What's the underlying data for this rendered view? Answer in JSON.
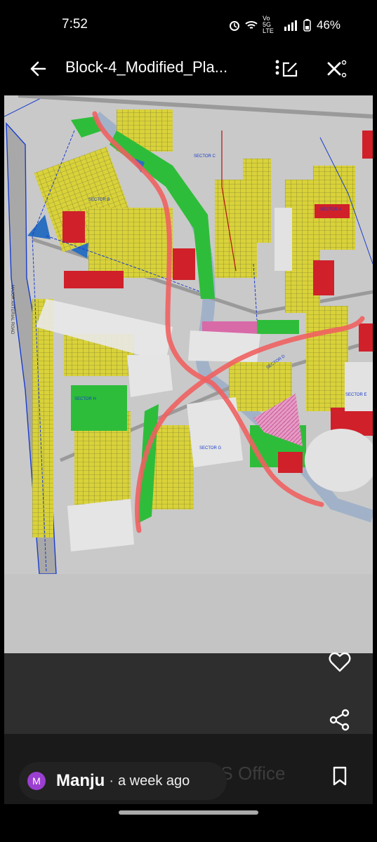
{
  "status_bar": {
    "time": "7:52",
    "network": "Vo 5G LTE",
    "battery": "46%"
  },
  "top_bar": {
    "back_icon": "arrow-left-icon",
    "title": "Block-4_Modified_Pla...",
    "edit_icon": "edit-icon",
    "close_icon": "close-icon"
  },
  "map": {
    "labels": {
      "sector_c": "SECTOR C",
      "sector_b": "SECTOR B",
      "sector_a": "SECTOR A",
      "sector_h": "SECTOR H",
      "sector_g": "SECTOR G",
      "sector_d": "SECTOR D",
      "sector_e": "SECTOR E",
      "road": "MAJOR ARTERIAL ROAD"
    },
    "colors": {
      "plots": "#d9d23a",
      "open_space": "#2ebd3a",
      "commercial": "#d0202a",
      "water": "#2a6fc0",
      "institutional": "#d86aa8",
      "annotation": "#f06060"
    }
  },
  "watermark": "Powered by WPS Office",
  "actions": {
    "favorite_icon": "heart-icon",
    "share_icon": "share-icon",
    "bookmark_icon": "bookmark-icon"
  },
  "author": {
    "avatar_letter": "M",
    "name": "Manju",
    "separator": "·",
    "time_ago": "a week ago"
  }
}
